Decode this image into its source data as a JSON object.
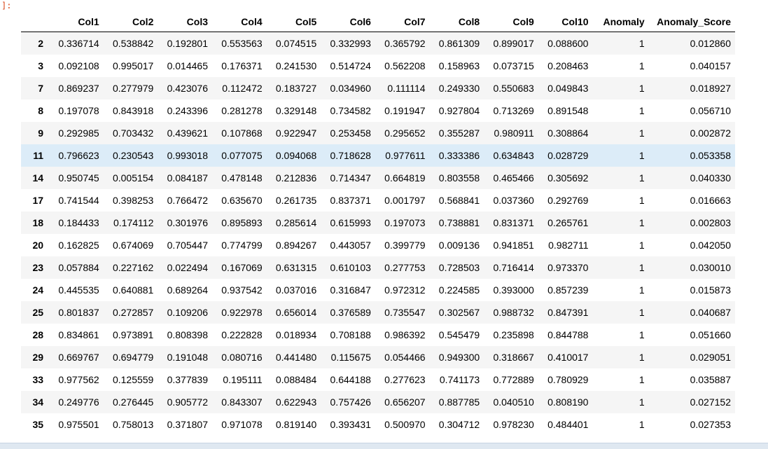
{
  "cell_prompt": "]:",
  "table": {
    "index_header": "",
    "columns": [
      "Col1",
      "Col2",
      "Col3",
      "Col4",
      "Col5",
      "Col6",
      "Col7",
      "Col8",
      "Col9",
      "Col10",
      "Anomaly",
      "Anomaly_Score"
    ],
    "rows": [
      {
        "index": "2",
        "values": [
          "0.336714",
          "0.538842",
          "0.192801",
          "0.553563",
          "0.074515",
          "0.332993",
          "0.365792",
          "0.861309",
          "0.899017",
          "0.088600",
          "1",
          "0.012860"
        ]
      },
      {
        "index": "3",
        "values": [
          "0.092108",
          "0.995017",
          "0.014465",
          "0.176371",
          "0.241530",
          "0.514724",
          "0.562208",
          "0.158963",
          "0.073715",
          "0.208463",
          "1",
          "0.040157"
        ]
      },
      {
        "index": "7",
        "values": [
          "0.869237",
          "0.277979",
          "0.423076",
          "0.112472",
          "0.183727",
          "0.034960",
          "0.111114",
          "0.249330",
          "0.550683",
          "0.049843",
          "1",
          "0.018927"
        ]
      },
      {
        "index": "8",
        "values": [
          "0.197078",
          "0.843918",
          "0.243396",
          "0.281278",
          "0.329148",
          "0.734582",
          "0.191947",
          "0.927804",
          "0.713269",
          "0.891548",
          "1",
          "0.056710"
        ]
      },
      {
        "index": "9",
        "values": [
          "0.292985",
          "0.703432",
          "0.439621",
          "0.107868",
          "0.922947",
          "0.253458",
          "0.295652",
          "0.355287",
          "0.980911",
          "0.308864",
          "1",
          "0.002872"
        ]
      },
      {
        "index": "11",
        "values": [
          "0.796623",
          "0.230543",
          "0.993018",
          "0.077075",
          "0.094068",
          "0.718628",
          "0.977611",
          "0.333386",
          "0.634843",
          "0.028729",
          "1",
          "0.053358"
        ]
      },
      {
        "index": "14",
        "values": [
          "0.950745",
          "0.005154",
          "0.084187",
          "0.478148",
          "0.212836",
          "0.714347",
          "0.664819",
          "0.803558",
          "0.465466",
          "0.305692",
          "1",
          "0.040330"
        ]
      },
      {
        "index": "17",
        "values": [
          "0.741544",
          "0.398253",
          "0.766472",
          "0.635670",
          "0.261735",
          "0.837371",
          "0.001797",
          "0.568841",
          "0.037360",
          "0.292769",
          "1",
          "0.016663"
        ]
      },
      {
        "index": "18",
        "values": [
          "0.184433",
          "0.174112",
          "0.301976",
          "0.895893",
          "0.285614",
          "0.615993",
          "0.197073",
          "0.738881",
          "0.831371",
          "0.265761",
          "1",
          "0.002803"
        ]
      },
      {
        "index": "20",
        "values": [
          "0.162825",
          "0.674069",
          "0.705447",
          "0.774799",
          "0.894267",
          "0.443057",
          "0.399779",
          "0.009136",
          "0.941851",
          "0.982711",
          "1",
          "0.042050"
        ]
      },
      {
        "index": "23",
        "values": [
          "0.057884",
          "0.227162",
          "0.022494",
          "0.167069",
          "0.631315",
          "0.610103",
          "0.277753",
          "0.728503",
          "0.716414",
          "0.973370",
          "1",
          "0.030010"
        ]
      },
      {
        "index": "24",
        "values": [
          "0.445535",
          "0.640881",
          "0.689264",
          "0.937542",
          "0.037016",
          "0.316847",
          "0.972312",
          "0.224585",
          "0.393000",
          "0.857239",
          "1",
          "0.015873"
        ]
      },
      {
        "index": "25",
        "values": [
          "0.801837",
          "0.272857",
          "0.109206",
          "0.922978",
          "0.656014",
          "0.376589",
          "0.735547",
          "0.302567",
          "0.988732",
          "0.847391",
          "1",
          "0.040687"
        ]
      },
      {
        "index": "28",
        "values": [
          "0.834861",
          "0.973891",
          "0.808398",
          "0.222828",
          "0.018934",
          "0.708188",
          "0.986392",
          "0.545479",
          "0.235898",
          "0.844788",
          "1",
          "0.051660"
        ]
      },
      {
        "index": "29",
        "values": [
          "0.669767",
          "0.694779",
          "0.191048",
          "0.080716",
          "0.441480",
          "0.115675",
          "0.054466",
          "0.949300",
          "0.318667",
          "0.410017",
          "1",
          "0.029051"
        ]
      },
      {
        "index": "33",
        "values": [
          "0.977562",
          "0.125559",
          "0.377839",
          "0.195111",
          "0.088484",
          "0.644188",
          "0.277623",
          "0.741173",
          "0.772889",
          "0.780929",
          "1",
          "0.035887"
        ]
      },
      {
        "index": "34",
        "values": [
          "0.249776",
          "0.276445",
          "0.905772",
          "0.843307",
          "0.622943",
          "0.757426",
          "0.656207",
          "0.887785",
          "0.040510",
          "0.808190",
          "1",
          "0.027152"
        ]
      },
      {
        "index": "35",
        "values": [
          "0.975501",
          "0.758013",
          "0.371807",
          "0.971078",
          "0.819140",
          "0.393431",
          "0.500970",
          "0.304712",
          "0.978230",
          "0.484401",
          "1",
          "0.027353"
        ]
      }
    ],
    "hovered_row_index": "11"
  },
  "colors": {
    "row_stripe": "#f5f5f5",
    "row_hover": "#dcecf8",
    "prompt": "#d84315"
  }
}
